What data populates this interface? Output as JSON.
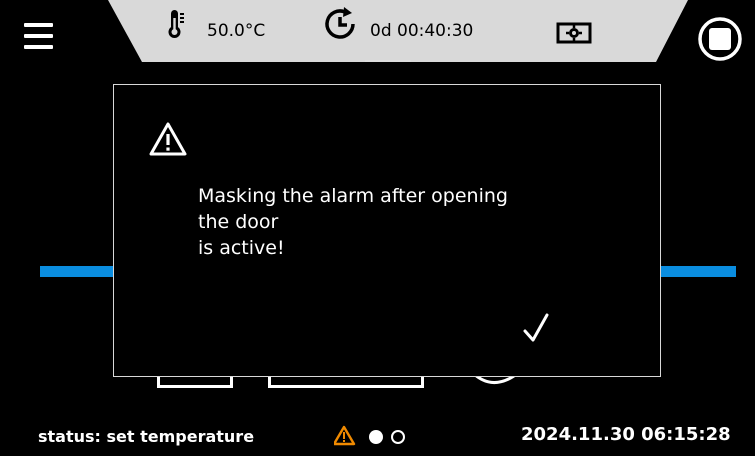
{
  "header": {
    "temperature": "50.0°C",
    "timer": "0d 00:40:30",
    "icons": {
      "menu": "hamburger-menu-icon",
      "thermometer": "thermometer-icon",
      "timer": "timer-clock-icon",
      "mode": "settings-mode-icon",
      "stop": "stop-icon"
    }
  },
  "dialog": {
    "icon": "warning-icon",
    "message_lines": [
      "Masking the alarm after opening",
      "the door",
      "is active!"
    ],
    "confirm_icon": "checkmark-icon"
  },
  "status_bar": {
    "status_text": "status: set temperature",
    "datetime": "2024.11.30  06:15:28",
    "alert_icon": "warning-icon",
    "pages": {
      "current": 1,
      "total": 2
    }
  },
  "colors": {
    "accent_blue": "#0a8de0",
    "panel_gray": "#d9d9d9",
    "alert_orange": "#f08a00",
    "background": "#000000"
  }
}
